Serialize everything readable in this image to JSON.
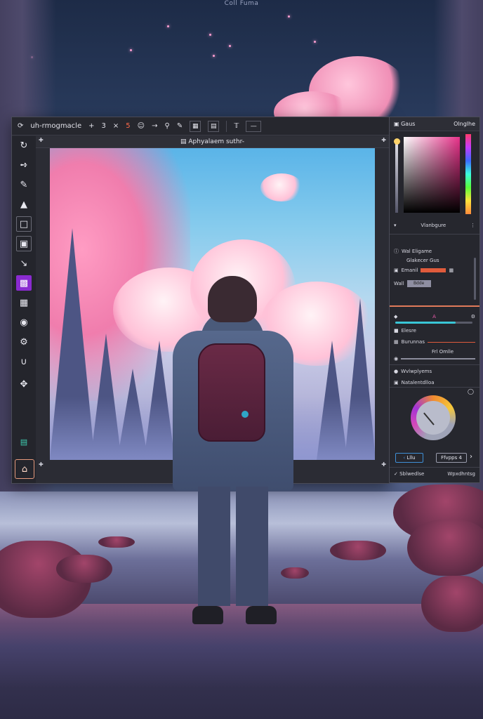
{
  "brand": {
    "title": "Coll Fuma"
  },
  "topbar": {
    "app_name": "uh-rmogmacle",
    "items": [
      "+",
      "3",
      "×",
      "5",
      "☺",
      "→"
    ],
    "icons": [
      "search-icon",
      "pen-icon",
      "grid-icon",
      "page-icon",
      "text-icon",
      "ruler-icon"
    ]
  },
  "document": {
    "title": "Aphyalaem suthr-"
  },
  "toolbar": {
    "tools": [
      "select-icon",
      "lasso-icon",
      "bucket-icon",
      "brush-icon",
      "stamp-icon",
      "frame-icon",
      "crop-icon",
      "wand-icon",
      "layers-icon",
      "grid-icon",
      "eye-icon",
      "gear-icon",
      "magnet-icon",
      "transform-icon",
      "waveform-icon",
      "home-icon"
    ],
    "active_tool": "layers-icon"
  },
  "panel": {
    "header_left": "Gaus",
    "header_right": "Olnglhe",
    "picker": {
      "label": "Vlanbgure",
      "accent_color": "#e8328a"
    },
    "section1": {
      "title": "Wal Eligame",
      "row1": "Glakecer Gus",
      "row2_label": "Emanil",
      "row3_label": "Wall",
      "row3_value": "Bdde"
    },
    "section2": {
      "label_a": "A",
      "row1": "Elesre",
      "row2": "Burunnas",
      "row3": "Frl Omlle",
      "row4": "Wvlwplyems",
      "row5": "Natalentdlloa"
    },
    "footer": {
      "left_button": "Lllu",
      "right_button": "Ffvpps 4",
      "bottom_left": "Sblwedlse",
      "bottom_right": "Wpxdhntsg"
    },
    "slider_value": 0.78
  }
}
